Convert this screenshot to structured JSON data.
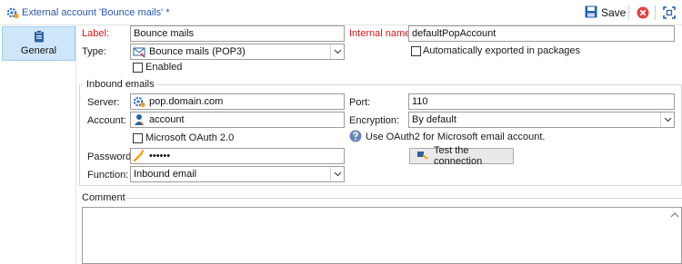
{
  "window": {
    "title": "External account 'Bounce mails' *"
  },
  "toolbar": {
    "save_label": "Save",
    "icons": [
      "save-icon",
      "close-icon",
      "expand-icon"
    ],
    "accent": "#2a56a8"
  },
  "sidebar": {
    "items": [
      {
        "label": "General",
        "icon": "clipboard-icon",
        "selected": true
      }
    ]
  },
  "form": {
    "label_caption": "Label:",
    "label_value": "Bounce mails",
    "internal_caption": "Internal name:",
    "internal_value": "defaultPopAccount",
    "type_caption": "Type:",
    "type_value": "Bounce mails (POP3)",
    "enabled_label": "Enabled",
    "enabled_checked": false,
    "auto_export_label": "Automatically exported in packages",
    "auto_export_checked": false,
    "required_color": "#d01818"
  },
  "inbound": {
    "group_title": "Inbound emails",
    "server_caption": "Server:",
    "server_value": "pop.domain.com",
    "port_caption": "Port:",
    "port_value": "110",
    "account_caption": "Account:",
    "account_value": "account",
    "encryption_caption": "Encryption:",
    "encryption_value": "By default",
    "oauth_label": "Microsoft OAuth 2.0",
    "oauth_checked": false,
    "oauth_hint": "Use OAuth2 for Microsoft email account.",
    "password_caption": "Password:",
    "password_value": "••••••",
    "function_caption": "Function:",
    "function_value": "Inbound email",
    "test_button_label": "Test the connection"
  },
  "comment": {
    "title": "Comment",
    "value": ""
  }
}
